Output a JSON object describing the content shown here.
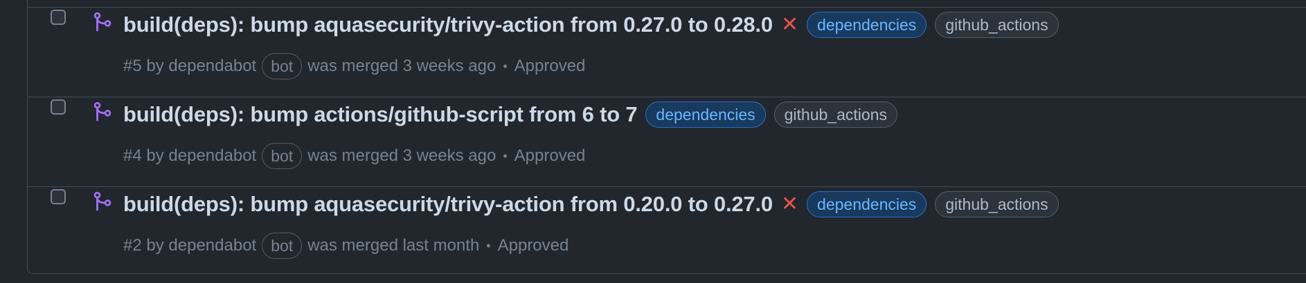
{
  "colors": {
    "background": "#22272e",
    "border": "#444c56",
    "merged_icon": "#a371f7",
    "closed_x": "#e5534b",
    "dependencies_label": "#6cb6ff",
    "github_actions_label": "#adbac7"
  },
  "pull_requests": [
    {
      "title": "build(deps): bump aquasecurity/trivy-action from 0.27.0 to 0.28.0",
      "status_icon": "x-icon",
      "status_mark": "✕",
      "labels": [
        "dependencies",
        "github_actions"
      ],
      "number": "#5",
      "by": "by",
      "author": "dependabot",
      "author_badge": "bot",
      "merged_text": "was merged 3 weeks ago",
      "separator": "•",
      "review": "Approved"
    },
    {
      "title": "build(deps): bump actions/github-script from 6 to 7",
      "status_icon": "",
      "status_mark": "",
      "labels": [
        "dependencies",
        "github_actions"
      ],
      "number": "#4",
      "by": "by",
      "author": "dependabot",
      "author_badge": "bot",
      "merged_text": "was merged 3 weeks ago",
      "separator": "•",
      "review": "Approved"
    },
    {
      "title": "build(deps): bump aquasecurity/trivy-action from 0.20.0 to 0.27.0",
      "status_icon": "x-icon",
      "status_mark": "✕",
      "labels": [
        "dependencies",
        "github_actions"
      ],
      "number": "#2",
      "by": "by",
      "author": "dependabot",
      "author_badge": "bot",
      "merged_text": "was merged last month",
      "separator": "•",
      "review": "Approved"
    }
  ]
}
